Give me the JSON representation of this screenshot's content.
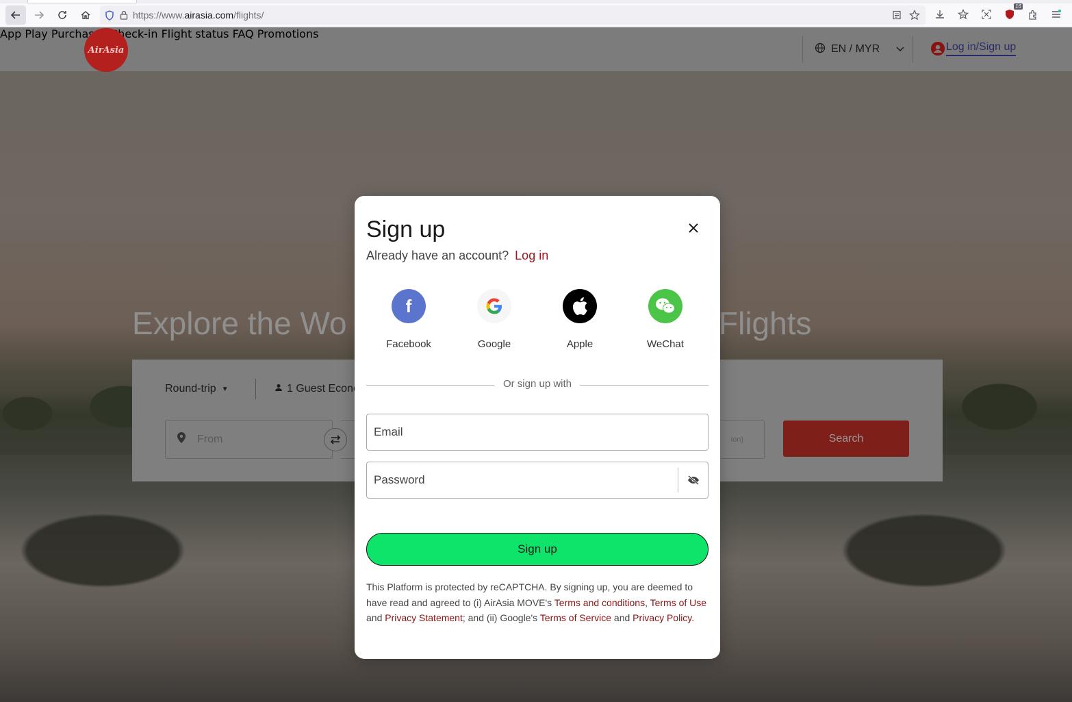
{
  "browser": {
    "url_prefix": "https://www.",
    "url_host": "airasia.com",
    "url_path": "/flights/",
    "ublock_count": "16"
  },
  "header": {
    "logo_text": "AirAsia",
    "nav": [
      "App",
      "Play",
      "Purchases",
      "Check-in",
      "Flight status",
      "FAQ",
      "Promotions"
    ],
    "language": "EN / MYR",
    "login_label": "Log in/Sign up"
  },
  "hero": {
    "title_left": "Explore the Wo",
    "title_right": "Flights"
  },
  "search": {
    "trip_type": "Round-trip",
    "guests": "1 Guest Econo",
    "from_placeholder": "From",
    "return_partial": "ion)",
    "search_label": "Search"
  },
  "modal": {
    "title": "Sign up",
    "already_text": "Already have an account?",
    "login_link": "Log in",
    "social": [
      {
        "name": "Facebook",
        "icon": "facebook-icon"
      },
      {
        "name": "Google",
        "icon": "google-icon"
      },
      {
        "name": "Apple",
        "icon": "apple-icon"
      },
      {
        "name": "WeChat",
        "icon": "wechat-icon"
      }
    ],
    "or_text": "Or sign up with",
    "email_placeholder": "Email",
    "password_placeholder": "Password",
    "signup_label": "Sign up",
    "legal": {
      "p1": "This Platform is protected by reCAPTCHA. By signing up, you are deemed to have read and agreed to (i) AirAsia MOVE's ",
      "terms_conditions": "Terms and conditions",
      "comma": ", ",
      "terms_use": "Terms of Use",
      "and1": " and ",
      "privacy_statement": "Privacy Statement",
      "p2": "; and (ii) Google's ",
      "terms_service": "Terms of Service",
      "and2": " and ",
      "privacy_policy": "Privacy Policy",
      "end": "."
    }
  },
  "colors": {
    "brand_red": "#b3201d",
    "link_red": "#a3151e",
    "signup_green": "#0fe46a"
  }
}
